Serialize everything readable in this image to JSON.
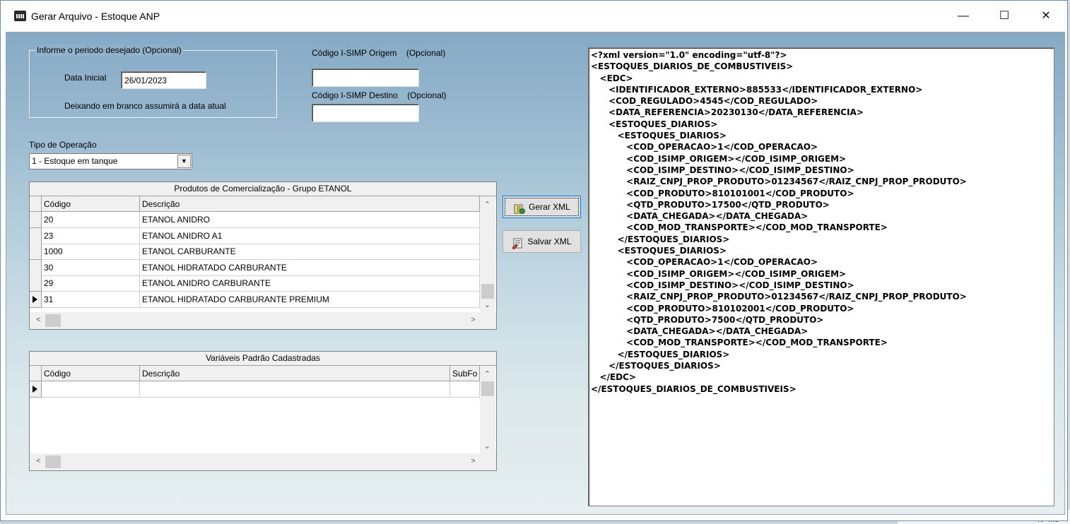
{
  "window": {
    "title": "Gerar Arquivo - Estoque ANP",
    "minimize_glyph": "—",
    "maximize_glyph": "☐",
    "close_glyph": "✕",
    "icon": "app-icon"
  },
  "period": {
    "legend": "Informe o periodo desejado (Opcional)",
    "data_inicial_label": "Data Inicial",
    "data_inicial_value": "26/01/2023",
    "hint": "Deixando em branco assumirá a data atual"
  },
  "isimp": {
    "origem_label": "Código I-SIMP Origem",
    "origem_optional": "(Opcional)",
    "origem_value": "",
    "destino_label": "Código I-SIMP Destino",
    "destino_optional": "(Opcional)",
    "destino_value": ""
  },
  "operacao": {
    "label": "Tipo de Operação",
    "selected": "1 - Estoque em tanque",
    "dropdown_glyph": "▼"
  },
  "produtos_grid": {
    "caption": "Produtos de Comercialização - Grupo ETANOL",
    "columns": [
      "Código",
      "Descrição"
    ],
    "rows": [
      {
        "codigo": "20",
        "descricao": "ETANOL ANIDRO"
      },
      {
        "codigo": "23",
        "descricao": "ETANOL ANIDRO A1"
      },
      {
        "codigo": "1000",
        "descricao": "ETANOL CARBURANTE"
      },
      {
        "codigo": "30",
        "descricao": "ETANOL HIDRATADO CARBURANTE"
      },
      {
        "codigo": "29",
        "descricao": "ETANOL ANIDRO CARBURANTE"
      },
      {
        "codigo": "31",
        "descricao": "ETANOL HIDRATADO CARBURANTE PREMIUM"
      }
    ],
    "current_row_index": 5
  },
  "variaveis_grid": {
    "caption": "Variáveis Padrão Cadastradas",
    "columns": [
      "Código",
      "Descrição",
      "SubFo"
    ]
  },
  "scroll_glyphs": {
    "up": "⌃",
    "down": "⌄",
    "left": "<",
    "right": ">"
  },
  "buttons": {
    "gerar_xml": "Gerar XML",
    "salvar_xml": "Salvar XML"
  },
  "xml_lines": [
    "<?xml version=\"1.0\" encoding=\"utf-8\"?>",
    "<ESTOQUES_DIARIOS_DE_COMBUSTIVEIS>",
    "   <EDC>",
    "      <IDENTIFICADOR_EXTERNO>885533</IDENTIFICADOR_EXTERNO>",
    "      <COD_REGULADO>4545</COD_REGULADO>",
    "      <DATA_REFERENCIA>20230130</DATA_REFERENCIA>",
    "      <ESTOQUES_DIARIOS>",
    "         <ESTOQUES_DIARIOS>",
    "            <COD_OPERACAO>1</COD_OPERACAO>",
    "            <COD_ISIMP_ORIGEM></COD_ISIMP_ORIGEM>",
    "            <COD_ISIMP_DESTINO></COD_ISIMP_DESTINO>",
    "            <RAIZ_CNPJ_PROP_PRODUTO>01234567</RAIZ_CNPJ_PROP_PRODUTO>",
    "            <COD_PRODUTO>810101001</COD_PRODUTO>",
    "            <QTD_PRODUTO>17500</QTD_PRODUTO>",
    "            <DATA_CHEGADA></DATA_CHEGADA>",
    "            <COD_MOD_TRANSPORTE></COD_MOD_TRANSPORTE>",
    "         </ESTOQUES_DIARIOS>",
    "         <ESTOQUES_DIARIOS>",
    "            <COD_OPERACAO>1</COD_OPERACAO>",
    "            <COD_ISIMP_ORIGEM></COD_ISIMP_ORIGEM>",
    "            <COD_ISIMP_DESTINO></COD_ISIMP_DESTINO>",
    "            <RAIZ_CNPJ_PROP_PRODUTO>01234567</RAIZ_CNPJ_PROP_PRODUTO>",
    "            <COD_PRODUTO>810102001</COD_PRODUTO>",
    "            <QTD_PRODUTO>7500</QTD_PRODUTO>",
    "            <DATA_CHEGADA></DATA_CHEGADA>",
    "            <COD_MOD_TRANSPORTE></COD_MOD_TRANSPORTE>",
    "         </ESTOQUES_DIARIOS>",
    "      </ESTOQUES_DIARIOS>",
    "   </EDC>",
    "</ESTOQUES_DIARIOS_DE_COMBUSTIVEIS>"
  ],
  "background_window": {
    "bottom_text": "Nº Mó"
  }
}
